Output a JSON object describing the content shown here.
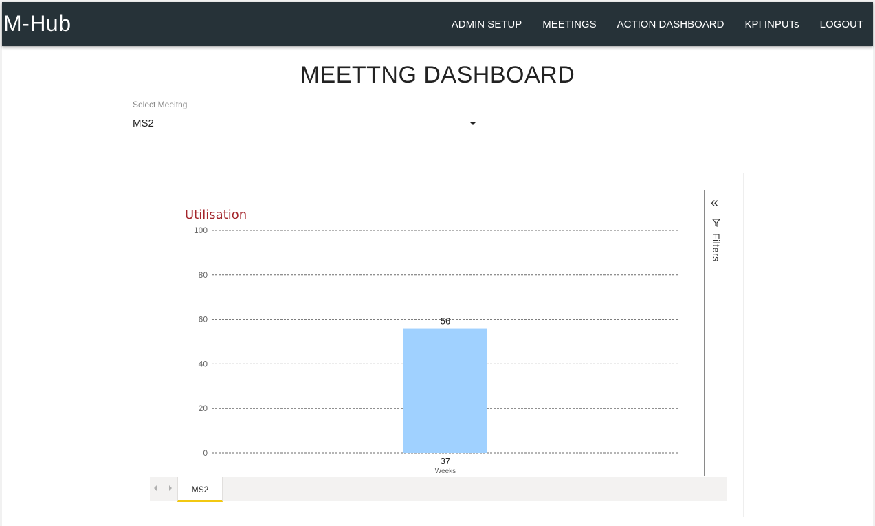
{
  "app": {
    "brand": "M-Hub",
    "nav": [
      "ADMIN SETUP",
      "MEETINGS",
      "ACTION DASHBOARD",
      "KPI INPUTs",
      "LOGOUT"
    ],
    "nav_bg": "#263238"
  },
  "page": {
    "title": "MEETTNG DASHBOARD"
  },
  "select": {
    "label": "Select Meeitng",
    "value": "MS2",
    "accent": "#26a69a"
  },
  "report": {
    "filters_label": "Filters",
    "tabs": [
      "MS2"
    ],
    "active_tab_color": "#f2c811"
  },
  "chart_data": {
    "type": "bar",
    "title": "Utilisation",
    "title_color": "#a4262c",
    "xlabel": "Weeks",
    "ylabel": "",
    "categories": [
      "37"
    ],
    "values": [
      56
    ],
    "ylim": [
      0,
      100
    ],
    "yticks": [
      0,
      20,
      40,
      60,
      80,
      100
    ],
    "grid": true,
    "bar_color": "#a0d1ff",
    "data_labels": true
  }
}
